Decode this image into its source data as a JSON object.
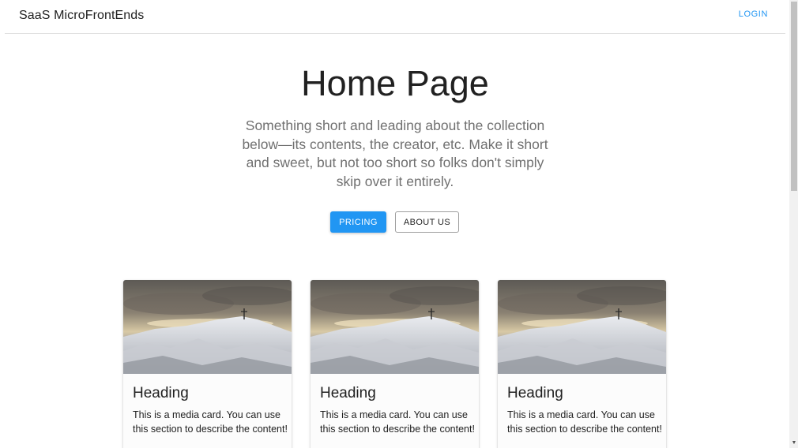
{
  "appbar": {
    "brand": "SaaS MicroFrontEnds",
    "login_label": "LOGIN"
  },
  "hero": {
    "title": "Home Page",
    "description": "Something short and leading about the collection below—its contents, the creator, etc. Make it short and sweet, but not too short so folks don't simply skip over it entirely.",
    "primary_button": "PRICING",
    "secondary_button": "ABOUT US"
  },
  "cards": [
    {
      "heading": "Heading",
      "text": "This is a media card. You can use this section to describe the content!",
      "image": "snowy-mountain-cross-image"
    },
    {
      "heading": "Heading",
      "text": "This is a media card. You can use this section to describe the content!",
      "image": "snowy-mountain-cross-image"
    },
    {
      "heading": "Heading",
      "text": "This is a media card. You can use this section to describe the content!",
      "image": "snowy-mountain-cross-image"
    }
  ],
  "colors": {
    "primary": "#2196f3",
    "text": "#212121",
    "muted_text": "#707070"
  },
  "icons": {
    "scroll_down": "scroll-down-arrow-icon"
  }
}
